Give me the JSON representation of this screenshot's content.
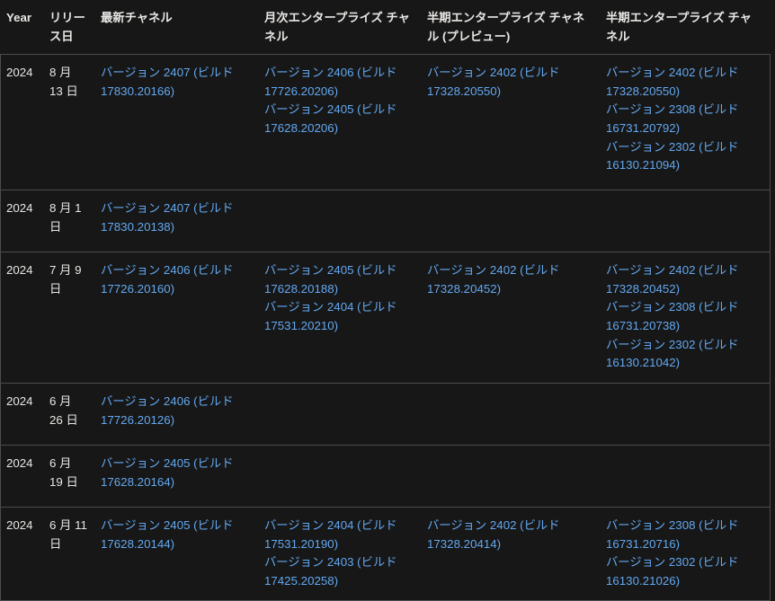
{
  "table": {
    "columns": [
      {
        "key": "year",
        "label": "Year"
      },
      {
        "key": "release_date",
        "label": "リリース日"
      },
      {
        "key": "current_channel",
        "label": "最新チャネル"
      },
      {
        "key": "monthly_enterprise_channel",
        "label": "月次エンタープライズ チャネル"
      },
      {
        "key": "semi_annual_preview_channel",
        "label": "半期エンタープライズ チャネル (プレビュー)"
      },
      {
        "key": "semi_annual_channel",
        "label": "半期エンタープライズ チャネル"
      }
    ],
    "rows": [
      {
        "year": "2024",
        "release_date": "8 月 13 日",
        "current_channel": [
          "バージョン 2407 (ビルド 17830.20166)"
        ],
        "monthly_enterprise_channel": [
          "バージョン 2406 (ビルド 17726.20206)",
          "バージョン 2405 (ビルド 17628.20206)"
        ],
        "semi_annual_preview_channel": [
          "バージョン 2402 (ビルド 17328.20550)"
        ],
        "semi_annual_channel": [
          "バージョン 2402 (ビルド 17328.20550)",
          "バージョン 2308 (ビルド 16731.20792)",
          "バージョン 2302 (ビルド 16130.21094)"
        ]
      },
      {
        "year": "2024",
        "release_date": "8 月 1 日",
        "current_channel": [
          "バージョン 2407 (ビルド 17830.20138)"
        ],
        "monthly_enterprise_channel": [],
        "semi_annual_preview_channel": [],
        "semi_annual_channel": []
      },
      {
        "year": "2024",
        "release_date": "7 月 9 日",
        "current_channel": [
          "バージョン 2406 (ビルド 17726.20160)"
        ],
        "monthly_enterprise_channel": [
          "バージョン 2405 (ビルド 17628.20188)",
          "バージョン 2404 (ビルド 17531.20210)"
        ],
        "semi_annual_preview_channel": [
          "バージョン 2402 (ビルド 17328.20452)"
        ],
        "semi_annual_channel": [
          "バージョン 2402 (ビルド 17328.20452)",
          "バージョン 2308 (ビルド 16731.20738)",
          "バージョン 2302 (ビルド 16130.21042)"
        ]
      },
      {
        "year": "2024",
        "release_date": "6 月 26 日",
        "current_channel": [
          "バージョン 2406 (ビルド 17726.20126)"
        ],
        "monthly_enterprise_channel": [],
        "semi_annual_preview_channel": [],
        "semi_annual_channel": []
      },
      {
        "year": "2024",
        "release_date": "6 月 19 日",
        "current_channel": [
          "バージョン 2405 (ビルド 17628.20164)"
        ],
        "monthly_enterprise_channel": [],
        "semi_annual_preview_channel": [],
        "semi_annual_channel": []
      },
      {
        "year": "2024",
        "release_date": "6 月 11 日",
        "current_channel": [
          "バージョン 2405 (ビルド 17628.20144)"
        ],
        "monthly_enterprise_channel": [
          "バージョン 2404 (ビルド 17531.20190)",
          "バージョン 2403 (ビルド 17425.20258)"
        ],
        "semi_annual_preview_channel": [
          "バージョン 2402 (ビルド 17328.20414)"
        ],
        "semi_annual_channel": [
          "バージョン 2308 (ビルド 16731.20716)",
          "バージョン 2302 (ビルド 16130.21026)"
        ]
      }
    ]
  },
  "colors": {
    "background": "#171717",
    "text": "#e9e7e4",
    "link": "#63a8f0",
    "border": "#4b4b4b"
  }
}
